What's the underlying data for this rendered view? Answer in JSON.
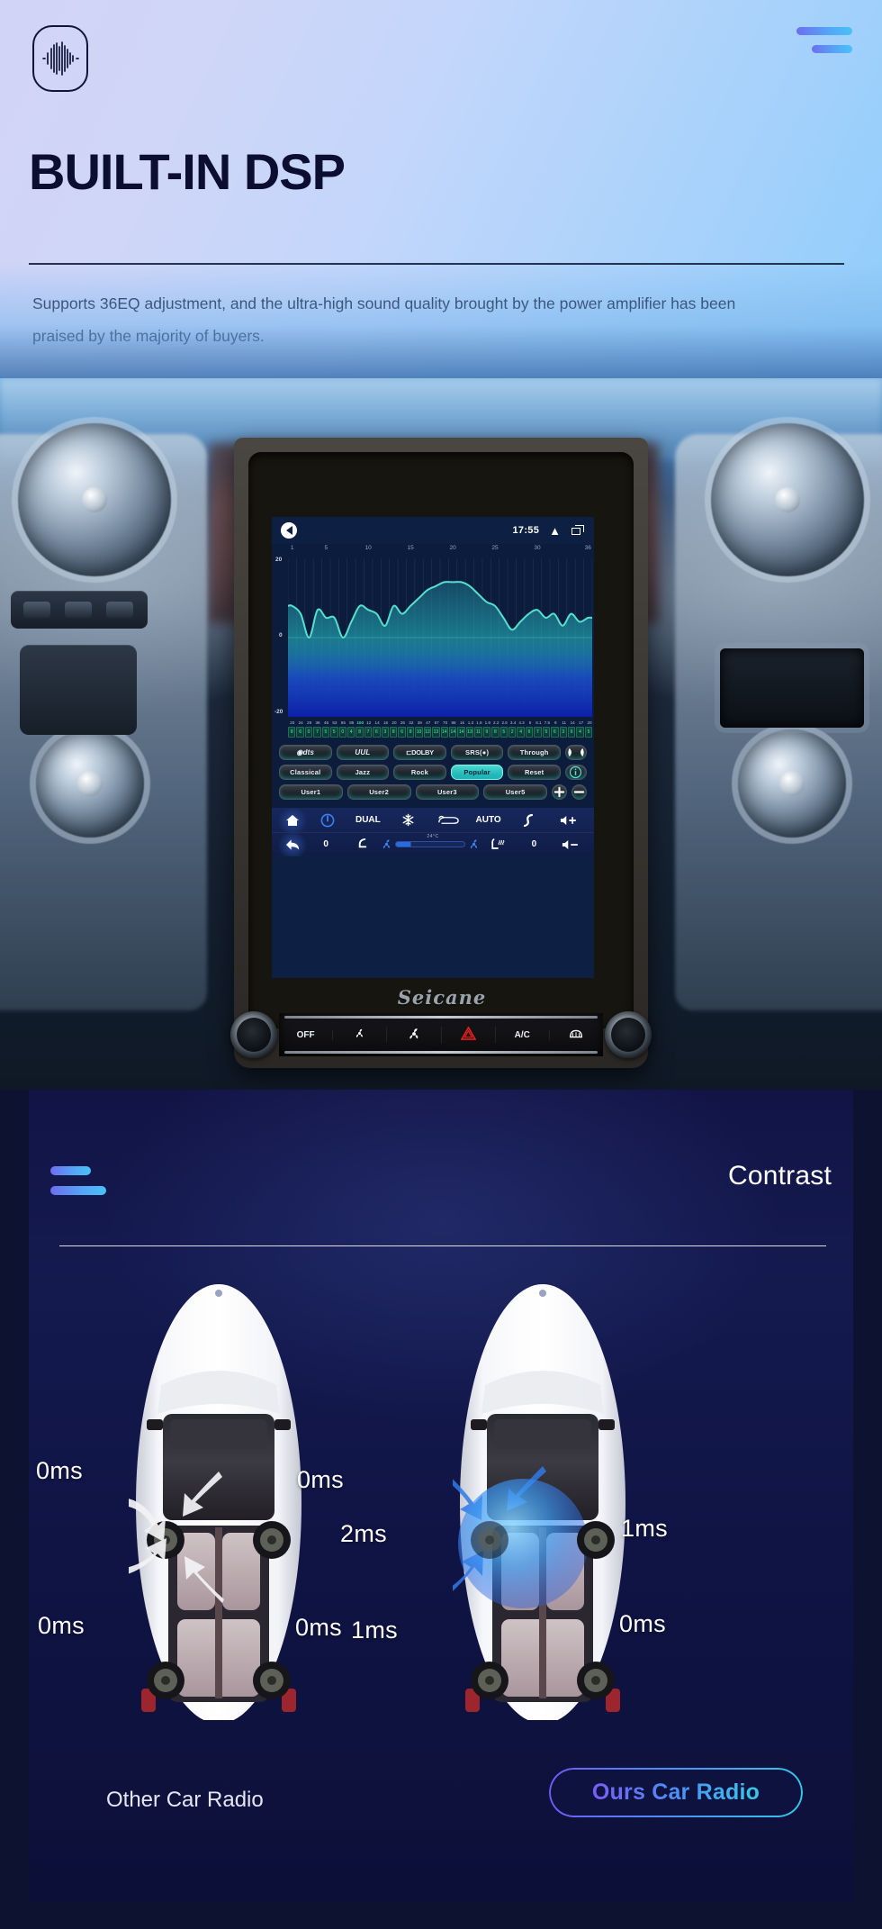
{
  "hero": {
    "logo_icon": "audio-waveform-icon",
    "menu_icon": "hamburger-menu-icon",
    "title": "BUILT-IN DSP",
    "description": "Supports 36EQ adjustment, and the ultra-high sound quality brought by the power amplifier has been praised by the majority of buyers."
  },
  "head_unit": {
    "brand": "Seicane",
    "status_bar": {
      "back_icon": "back-arrow-icon",
      "time": "17:55",
      "chevron_icon": "chevron-up-icon",
      "recents_icon": "recent-apps-icon"
    },
    "eq": {
      "y_top": "20",
      "y_zero": "0",
      "y_bottom": "-20",
      "x_ticks": [
        "1",
        "5",
        "10",
        "15",
        "20",
        "25",
        "30",
        "36"
      ],
      "frequencies": [
        "20",
        "24",
        "29",
        "36",
        "46",
        "53",
        "65",
        "85",
        "100",
        "12",
        "14",
        "16",
        "20",
        "26",
        "32",
        "39",
        "47",
        "57",
        "70",
        "86",
        "1k",
        "1.3",
        "1.6",
        "1.9",
        "2.2",
        "2.6",
        "3.4",
        "4.3",
        "5",
        "6.1",
        "7.5",
        "9",
        "11",
        "14",
        "17",
        "20"
      ],
      "highlight_index": 8,
      "values": [
        "8",
        "6",
        "0",
        "7",
        "5",
        "5",
        "0",
        "4",
        "8",
        "7",
        "6",
        "3",
        "8",
        "6",
        "8",
        "10",
        "12",
        "13",
        "14",
        "14",
        "14",
        "13",
        "11",
        "9",
        "8",
        "5",
        "2",
        "4",
        "6",
        "7",
        "5",
        "6",
        "3",
        "6",
        "4",
        "5"
      ]
    },
    "presets": {
      "row1": [
        {
          "label": "dts",
          "icon": "dts-logo-icon",
          "active": false
        },
        {
          "label": "UUL",
          "icon": "uul-logo-icon",
          "active": false
        },
        {
          "label": "DOLBY",
          "icon": "dolby-logo-icon",
          "active": false
        },
        {
          "label": "SRS(●)",
          "icon": "srs-logo-icon",
          "active": false
        },
        {
          "label": "Through",
          "icon": "",
          "active": false
        },
        {
          "label": "",
          "icon": "balance-speaker-icon",
          "active": false
        }
      ],
      "row2": [
        {
          "label": "Classical",
          "icon": "",
          "active": false
        },
        {
          "label": "Jazz",
          "icon": "",
          "active": false
        },
        {
          "label": "Rock",
          "icon": "",
          "active": false
        },
        {
          "label": "Popular",
          "icon": "",
          "active": true
        },
        {
          "label": "Reset",
          "icon": "",
          "active": false
        },
        {
          "label": "",
          "icon": "info-icon",
          "active": false
        }
      ],
      "row3": [
        {
          "label": "User1",
          "icon": "",
          "active": false
        },
        {
          "label": "User2",
          "icon": "",
          "active": false
        },
        {
          "label": "User3",
          "icon": "",
          "active": false
        },
        {
          "label": "User5",
          "icon": "",
          "active": false
        },
        {
          "label": "+",
          "icon": "plus-icon",
          "active": false
        },
        {
          "label": "−",
          "icon": "minus-icon",
          "active": false
        }
      ]
    },
    "climate": {
      "home_icon": "home-icon",
      "power_icon": "power-icon",
      "dual_label": "DUAL",
      "ac_icon": "snowflake-icon",
      "recirculate_icon": "air-recirculation-icon",
      "auto_label": "AUTO",
      "airflow_icon": "airflow-up-icon",
      "volume_up_icon": "volume-up-icon",
      "temperature": "24°C",
      "back_icon": "back-arrow-icon",
      "left_temp": "0",
      "seat_airflow_icon": "seat-airflow-icon",
      "fan_left_icon": "fan-icon",
      "fan_right_icon": "fan-icon",
      "seat_heat_icon": "seat-heat-icon",
      "right_temp": "0",
      "volume_down_icon": "volume-down-icon"
    },
    "hardware_buttons": [
      {
        "label": "OFF",
        "icon": ""
      },
      {
        "label": "",
        "icon": "fan-low-icon"
      },
      {
        "label": "",
        "icon": "fan-high-icon"
      },
      {
        "label": "",
        "icon": "hazard-warning-icon"
      },
      {
        "label": "A/C",
        "icon": ""
      },
      {
        "label": "",
        "icon": "rear-defroster-icon"
      }
    ]
  },
  "contrast": {
    "menu_icon": "hamburger-menu-icon",
    "title": "Contrast",
    "left_car": {
      "caption": "Other Car Radio",
      "labels": {
        "front_left": "0ms",
        "front_right": "0ms",
        "rear_left": "0ms",
        "rear_right": "0ms"
      }
    },
    "right_car": {
      "caption": "Ours Car Radio",
      "labels": {
        "front_left": "2ms",
        "front_right": "1ms",
        "rear_left": "1ms",
        "rear_right": "0ms"
      }
    }
  },
  "colors": {
    "accent_blue": "#4f8df5",
    "accent_purple": "#6f5bf7",
    "accent_cyan": "#35c6e8",
    "eq_curve": "#4fe3d0",
    "active_preset": "#2bbfbe",
    "hazard_red": "#e01f1f",
    "contrast_bg": "#121446"
  }
}
